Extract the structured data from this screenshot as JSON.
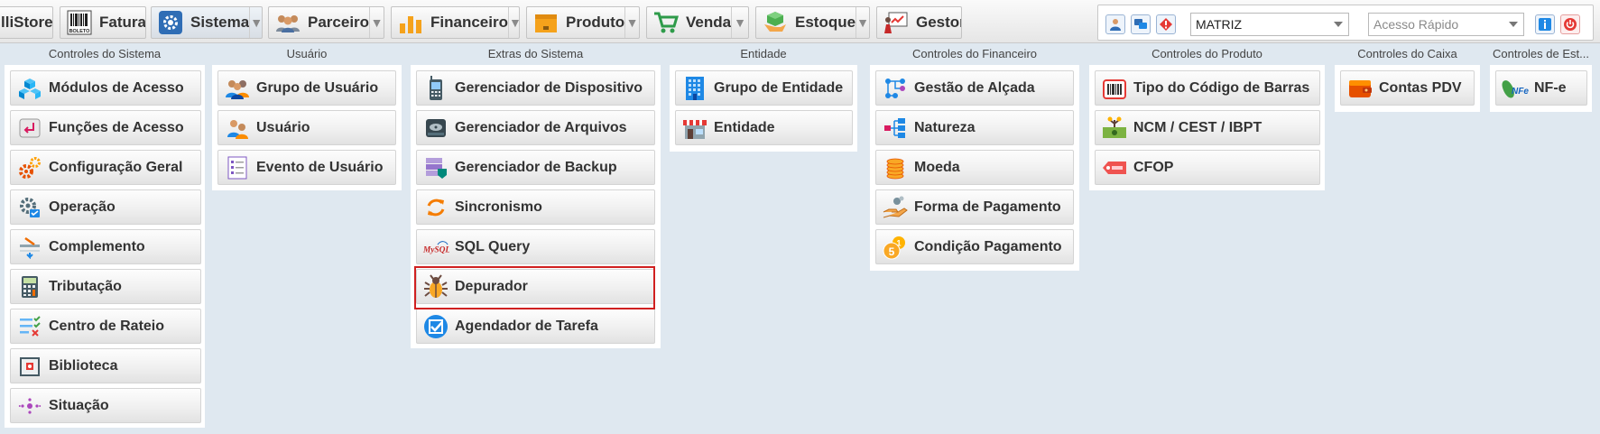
{
  "topbar": {
    "tabs": [
      {
        "label": "lliStore",
        "icon": "store-icon"
      },
      {
        "label": "Fatura",
        "icon": "barcode-boleto-icon",
        "icon_text": "BOLETO"
      },
      {
        "label": "Sistema",
        "icon": "gear-icon",
        "active": true
      },
      {
        "label": "Parceiro",
        "icon": "users-group-icon"
      },
      {
        "label": "Financeiro",
        "icon": "bar-chart-icon"
      },
      {
        "label": "Produto",
        "icon": "box-icon"
      },
      {
        "label": "Venda",
        "icon": "shopping-cart-icon"
      },
      {
        "label": "Estoque",
        "icon": "stock-hand-icon"
      },
      {
        "label": "Gestor",
        "icon": "presentation-board-icon"
      }
    ],
    "company_select": "MATRIZ",
    "quick_access_placeholder": "Acesso Rápido"
  },
  "menu": {
    "groups": [
      {
        "title": "Controles do Sistema",
        "items": [
          {
            "label": "Módulos de Acesso",
            "icon": "cubes-icon"
          },
          {
            "label": "Funções de Acesso",
            "icon": "enter-key-icon"
          },
          {
            "label": "Configuração Geral",
            "icon": "gears-icon"
          },
          {
            "label": "Operação",
            "icon": "gear-check-icon"
          },
          {
            "label": "Complemento",
            "icon": "form-edit-icon"
          },
          {
            "label": "Tributação",
            "icon": "calculator-icon"
          },
          {
            "label": "Centro de Rateio",
            "icon": "list-check-icon"
          },
          {
            "label": "Biblioteca",
            "icon": "library-icon"
          },
          {
            "label": "Situação",
            "icon": "dots-status-icon"
          }
        ]
      },
      {
        "title": "Usuário",
        "items": [
          {
            "label": "Grupo de Usuário",
            "icon": "user-group-icon"
          },
          {
            "label": "Usuário",
            "icon": "user-icon"
          },
          {
            "label": "Evento de Usuário",
            "icon": "checklist-icon"
          }
        ]
      },
      {
        "title": "Extras do Sistema",
        "items": [
          {
            "label": "Gerenciador de Dispositivo",
            "icon": "phone-device-icon"
          },
          {
            "label": "Gerenciador de Arquivos",
            "icon": "hard-disk-icon"
          },
          {
            "label": "Gerenciador de Backup",
            "icon": "backup-server-icon"
          },
          {
            "label": "Sincronismo",
            "icon": "sync-icon"
          },
          {
            "label": "SQL Query",
            "icon": "mysql-icon",
            "icon_text": "MySQL"
          },
          {
            "label": "Depurador",
            "icon": "bug-icon",
            "highlighted": true
          },
          {
            "label": "Agendador de Tarefa",
            "icon": "checkbox-task-icon"
          }
        ]
      },
      {
        "title": "Entidade",
        "items": [
          {
            "label": "Grupo de Entidade",
            "icon": "building-icon"
          },
          {
            "label": "Entidade",
            "icon": "store-front-icon"
          }
        ]
      },
      {
        "title": "Controles do Financeiro",
        "items": [
          {
            "label": "Gestão de Alçada",
            "icon": "workflow-icon"
          },
          {
            "label": "Natureza",
            "icon": "hierarchy-icon"
          },
          {
            "label": "Moeda",
            "icon": "coins-icon"
          },
          {
            "label": "Forma de Pagamento",
            "icon": "hand-money-icon"
          },
          {
            "label": "Condição Pagamento",
            "icon": "coins-number-icon",
            "icon_text": "1 5"
          }
        ]
      },
      {
        "title": "Controles do Produto",
        "items": [
          {
            "label": "Tipo do Código de Barras",
            "icon": "barcode-scanner-icon"
          },
          {
            "label": "NCM / CEST / IBPT",
            "icon": "money-tree-icon"
          },
          {
            "label": "CFOP",
            "icon": "tag-icon"
          }
        ]
      },
      {
        "title": "Controles do Caixa",
        "items": [
          {
            "label": "Contas PDV",
            "icon": "wallet-icon"
          }
        ]
      },
      {
        "title": "Controles de Est...",
        "items": [
          {
            "label": "NF-e",
            "icon": "nfe-icon",
            "icon_text": "NFe"
          }
        ]
      }
    ]
  }
}
